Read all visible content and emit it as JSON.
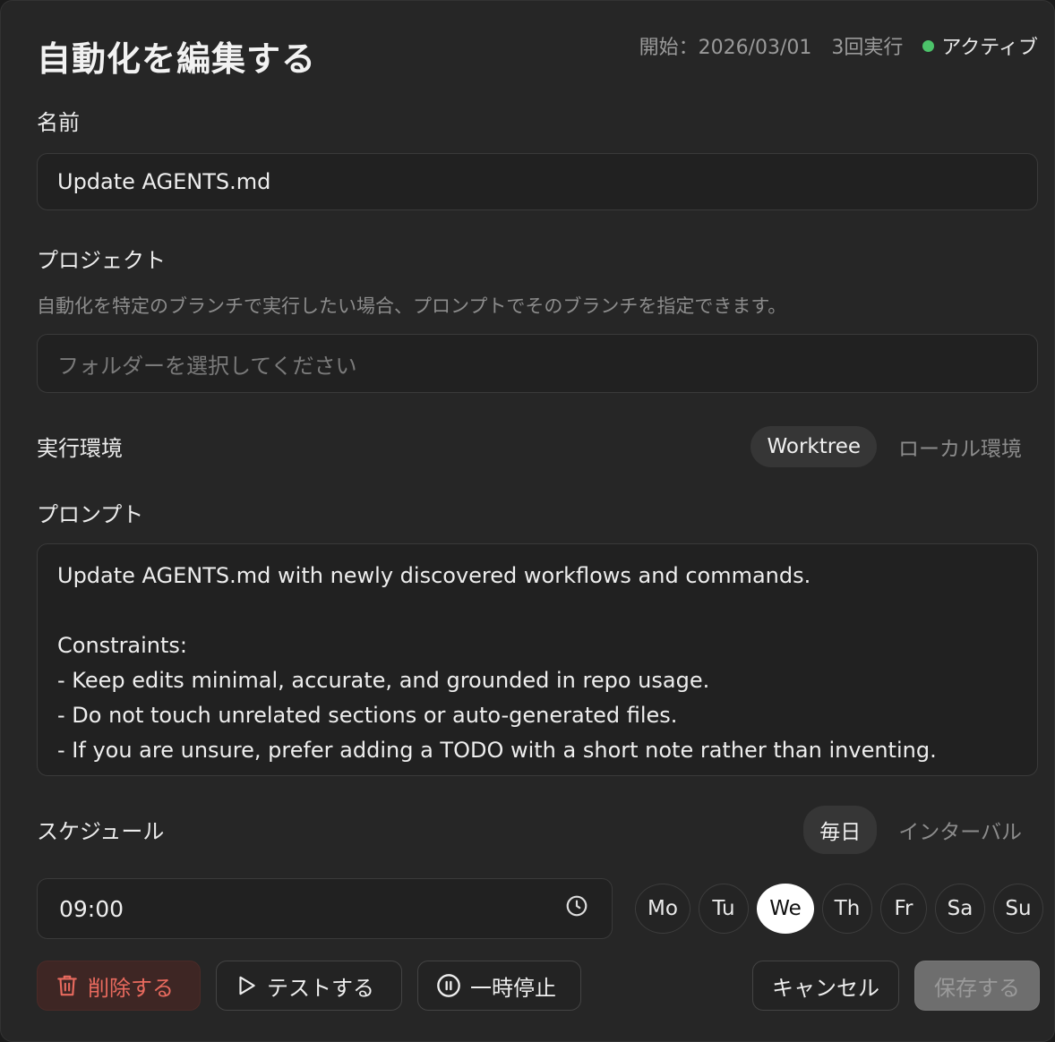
{
  "header": {
    "title": "自動化を編集する",
    "start_label": "開始：2026/03/01",
    "run_count": "3回実行",
    "status": "アクティブ",
    "status_color": "#4cc36a"
  },
  "name": {
    "label": "名前",
    "value": "Update AGENTS.md"
  },
  "project": {
    "label": "プロジェクト",
    "hint": "自動化を特定のブランチで実行したい場合、プロンプトでそのブランチを指定できます。",
    "placeholder": "フォルダーを選択してください"
  },
  "environment": {
    "label": "実行環境",
    "options": [
      "Worktree",
      "ローカル環境"
    ],
    "selected": "Worktree"
  },
  "prompt": {
    "label": "プロンプト",
    "lines": [
      "Update AGENTS.md with newly discovered workflows and commands.",
      "",
      "Constraints:",
      "- Keep edits minimal, accurate, and grounded in repo usage.",
      "- Do not touch unrelated sections or auto-generated files.",
      "- If you are unsure, prefer adding a TODO with a short note rather than inventing."
    ]
  },
  "schedule": {
    "label": "スケジュール",
    "options": [
      "毎日",
      "インターバル"
    ],
    "selected": "毎日",
    "time": "09:00",
    "days": [
      "Mo",
      "Tu",
      "We",
      "Th",
      "Fr",
      "Sa",
      "Su"
    ],
    "selected_day": "We"
  },
  "actions": {
    "delete": "削除する",
    "test": "テストする",
    "pause": "一時停止",
    "cancel": "キャンセル",
    "save": "保存する"
  },
  "colors": {
    "danger": "#e86a5e",
    "accent": "#ffffff"
  }
}
